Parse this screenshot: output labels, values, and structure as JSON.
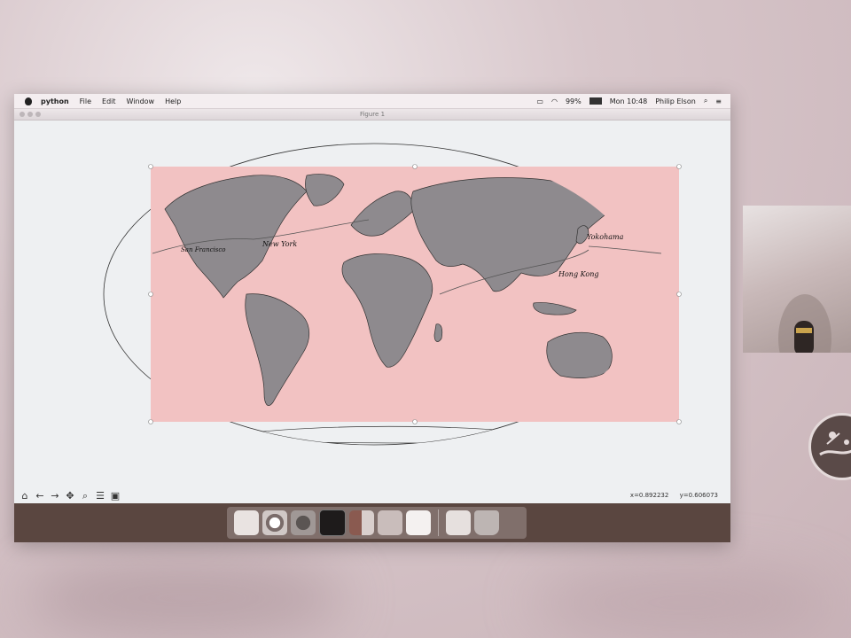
{
  "menubar": {
    "app_name": "python",
    "items": [
      "File",
      "Edit",
      "Window",
      "Help"
    ],
    "battery": "99%",
    "clock": "Mon 10:48",
    "user": "Philip Elson"
  },
  "window": {
    "title": "Figure 1"
  },
  "map": {
    "labels": [
      "San Francisco",
      "New York",
      "Yokohama",
      "Hong Kong"
    ],
    "colors": {
      "background": "#f2c2c2",
      "land": "#8e8a8e",
      "outline": "#333333"
    }
  },
  "toolbar": {
    "icons": [
      "home-icon",
      "back-icon",
      "forward-icon",
      "pan-icon",
      "zoom-icon",
      "configure-icon",
      "save-icon"
    ]
  },
  "status": {
    "x": "x=0.892232",
    "y": "y=0.606073"
  },
  "dock": {
    "apps": [
      "finder-icon",
      "chrome-icon",
      "system-preferences-icon",
      "terminal-icon",
      "powerpoint-icon",
      "acrobat-icon",
      "document-icon",
      "preview-icon",
      "trash-icon"
    ]
  }
}
